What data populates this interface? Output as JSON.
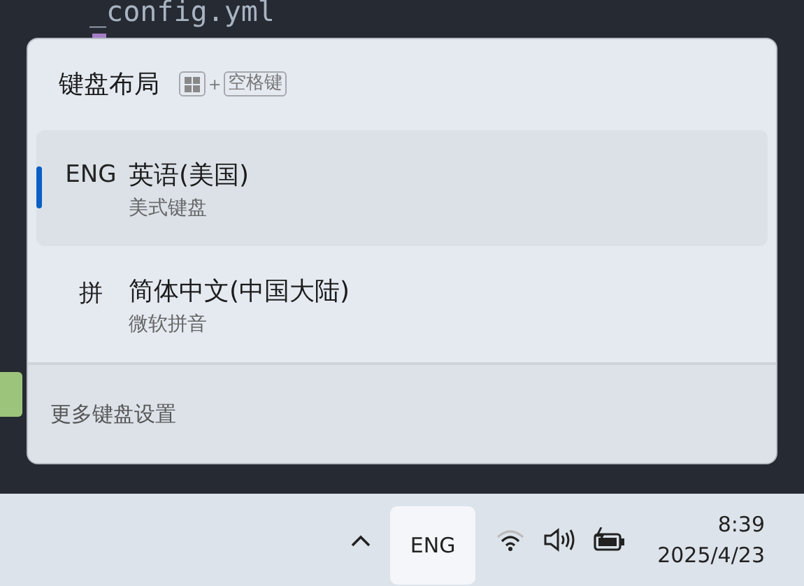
{
  "editor": {
    "files": [
      {
        "name": "_config.yml"
      }
    ]
  },
  "popup": {
    "title": "键盘布局",
    "shortcut": {
      "plus": "+",
      "key": "空格键"
    },
    "layouts": [
      {
        "code": "ENG",
        "name": "英语(美国)",
        "keyboard": "美式键盘",
        "selected": true
      },
      {
        "code": "拼",
        "name": "简体中文(中国大陆)",
        "keyboard": "微软拼音",
        "selected": false
      }
    ],
    "footer": "更多键盘设置"
  },
  "taskbar": {
    "language": "ENG",
    "time": "8:39",
    "date": "2025/4/23"
  }
}
